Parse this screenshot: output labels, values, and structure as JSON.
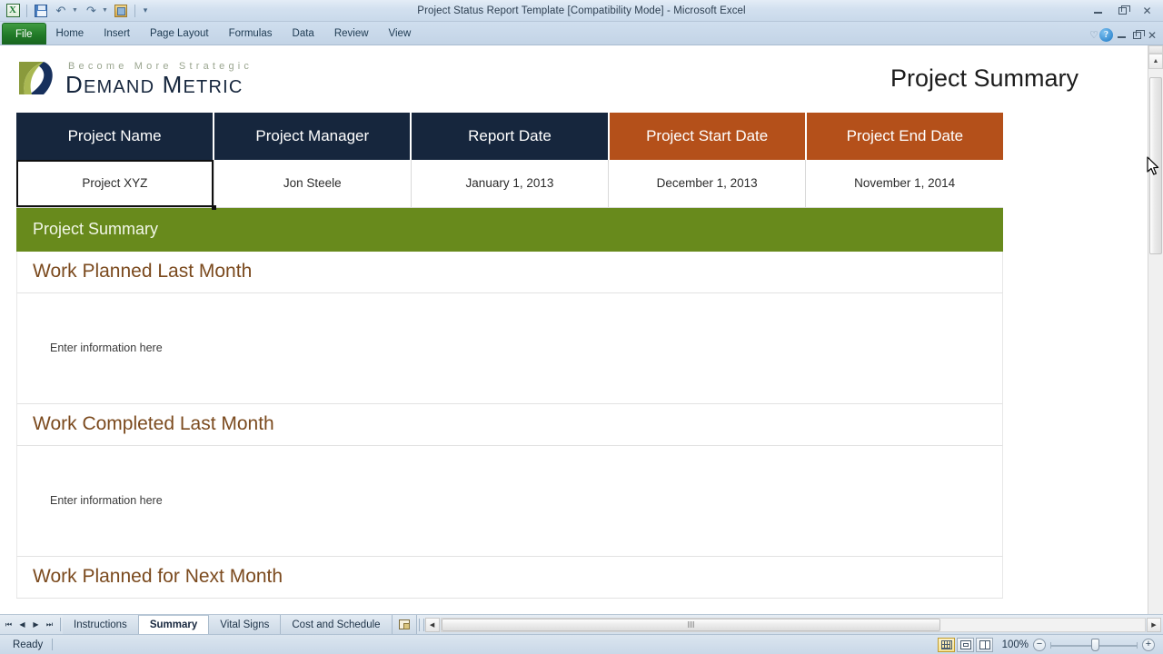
{
  "window": {
    "title": "Project Status Report Template  [Compatibility Mode]  -  Microsoft Excel",
    "minimize_label": "Minimize",
    "restore_label": "Restore Down",
    "close_label": "Close"
  },
  "quick_access": {
    "app_icon": "excel-logo-icon",
    "items": [
      {
        "name": "save-icon",
        "label": "Save"
      },
      {
        "name": "undo-icon",
        "label": "Undo"
      },
      {
        "name": "redo-icon",
        "label": "Redo"
      },
      {
        "name": "print-preview-icon",
        "label": "Print Preview and Print"
      },
      {
        "name": "customize-qat-icon",
        "label": "Customize Quick Access Toolbar"
      }
    ]
  },
  "ribbon": {
    "file_tab": "File",
    "tabs": [
      "Home",
      "Insert",
      "Page Layout",
      "Formulas",
      "Data",
      "Review",
      "View"
    ],
    "right_icons": [
      {
        "name": "heart-icon",
        "glyph": "♡"
      },
      {
        "name": "help-icon",
        "glyph": "?"
      },
      {
        "name": "minimize-ribbon-icon",
        "glyph": "–"
      },
      {
        "name": "restore-window-icon",
        "glyph": "❐"
      },
      {
        "name": "close-window-icon",
        "glyph": "✕"
      }
    ]
  },
  "document": {
    "logo": {
      "tagline": "Become  More  Strategic",
      "name_part1": "D",
      "name_rest1": "EMAND",
      "name_part2": "M",
      "name_rest2": "ETRIC"
    },
    "page_title": "Project Summary",
    "table": {
      "headers": [
        {
          "label": "Project Name",
          "style": "navy"
        },
        {
          "label": "Project Manager",
          "style": "navy"
        },
        {
          "label": "Report Date",
          "style": "navy"
        },
        {
          "label": "Project Start Date",
          "style": "orange"
        },
        {
          "label": "Project End Date",
          "style": "orange"
        }
      ],
      "row": [
        "Project XYZ",
        "Jon Steele",
        "January 1, 2013",
        "December 1, 2013",
        "November 1, 2014"
      ],
      "selected_cell_index": 0
    },
    "section_band": "Project Summary",
    "sections": [
      {
        "heading": "Work Planned Last Month",
        "body": "Enter information here"
      },
      {
        "heading": "Work Completed Last Month",
        "body": "Enter information here"
      },
      {
        "heading": "Work Planned for Next Month",
        "body": ""
      }
    ]
  },
  "sheet_tabs": {
    "nav": [
      {
        "name": "first-sheet-icon",
        "glyph": "⏮"
      },
      {
        "name": "prev-sheet-icon",
        "glyph": "◀"
      },
      {
        "name": "next-sheet-icon",
        "glyph": "▶"
      },
      {
        "name": "last-sheet-icon",
        "glyph": "⏭"
      }
    ],
    "tabs": [
      {
        "label": "Instructions",
        "active": false
      },
      {
        "label": "Summary",
        "active": true
      },
      {
        "label": "Vital Signs",
        "active": false
      },
      {
        "label": "Cost and Schedule",
        "active": false
      }
    ],
    "insert_sheet_label": "Insert Worksheet"
  },
  "status_bar": {
    "state": "Ready",
    "views": [
      {
        "name": "normal-view-button",
        "selected": true
      },
      {
        "name": "page-layout-view-button",
        "selected": false
      },
      {
        "name": "page-break-preview-button",
        "selected": false
      }
    ],
    "zoom_level": "100%",
    "zoom_out_label": "−",
    "zoom_in_label": "+"
  },
  "colors": {
    "navy_header": "#16263d",
    "orange_header": "#b4501a",
    "green_band": "#688a1c",
    "section_heading": "#7b4a1e",
    "file_tab_green": "#217a28"
  }
}
